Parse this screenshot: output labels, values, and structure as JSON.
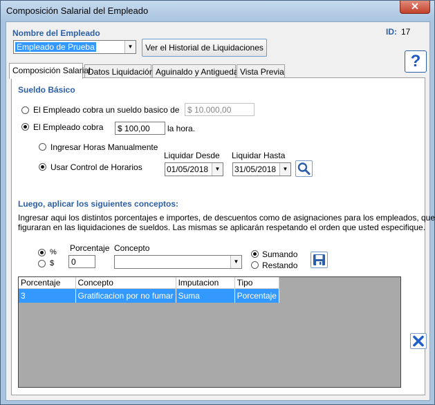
{
  "window": {
    "title": "Composición Salarial del Empleado",
    "close_glyph": "✕"
  },
  "header": {
    "employee_label": "Nombre del Empleado",
    "employee_value": "Empleado de Prueba",
    "id_label": "ID:",
    "id_value": "17",
    "history_button": "Ver el Historial de Liquidaciones",
    "help_glyph": "?"
  },
  "tabs": [
    {
      "label": "Composición Salarial",
      "active": true
    },
    {
      "label": "Datos Liquidación"
    },
    {
      "label": "Aguinaldo y Antiguedad"
    },
    {
      "label": "Vista Previa"
    }
  ],
  "basic_salary": {
    "title": "Sueldo Básico",
    "option_fixed_label": "El Empleado cobra un sueldo basico de",
    "fixed_value": "$ 10.000,00",
    "option_hourly_label": "El Empleado cobra",
    "hourly_value": "$ 100,00",
    "hourly_suffix": "la hora.",
    "manual_hours_label": "Ingresar Horas Manualmente",
    "schedule_control_label": "Usar Control de Horarios",
    "from_label": "Liquidar Desde",
    "from_value": "01/05/2018",
    "to_label": "Liquidar Hasta",
    "to_value": "31/05/2018"
  },
  "concepts": {
    "title": "Luego, aplicar los siguientes conceptos:",
    "description_line1": "Ingresar aqui los distintos porcentajes e importes, de descuentos como de asignaciones para los empleados, que",
    "description_line2": "figuraran en las liquidaciones de sueldos. Las mismas se aplicarán respetando el orden que usted especifique.",
    "percent_symbol": "%",
    "dollar_symbol": "$",
    "percentage_label": "Porcentaje",
    "percentage_value": "0",
    "concept_label": "Concepto",
    "concept_value": "",
    "add_label": "Sumando",
    "subtract_label": "Restando"
  },
  "grid": {
    "columns": [
      "Porcentaje",
      "Concepto",
      "Imputacion",
      "Tipo"
    ],
    "rows": [
      [
        "3",
        "Gratificacion por no fumar",
        "Suma",
        "Porcentaje"
      ]
    ]
  },
  "colors": {
    "accent": "#2b5fa8",
    "selection": "#3399ff",
    "titlebar": "#a9c4df",
    "close": "#c3422b"
  }
}
